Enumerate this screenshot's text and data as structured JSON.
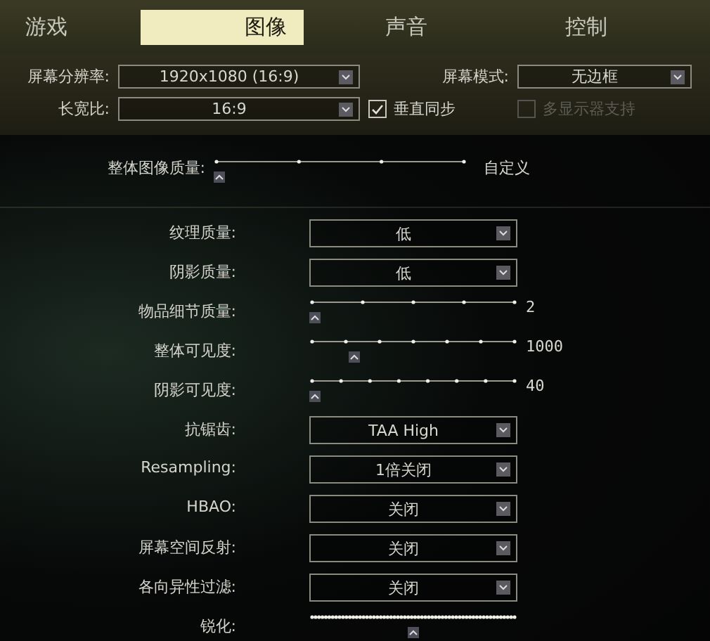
{
  "tabs": [
    {
      "label": "游戏",
      "selected": false
    },
    {
      "label": "图像",
      "selected": true
    },
    {
      "label": "声音",
      "selected": false
    },
    {
      "label": "控制",
      "selected": false
    }
  ],
  "resolution": {
    "label": "屏幕分辨率:",
    "value": "1920x1080 (16:9)"
  },
  "screen_mode": {
    "label": "屏幕模式:",
    "value": "无边框"
  },
  "aspect_ratio": {
    "label": "长宽比:",
    "value": "16:9"
  },
  "vsync": {
    "label": "垂直同步",
    "checked": true,
    "disabled": false
  },
  "multi_monitor": {
    "label": "多显示器支持",
    "checked": false,
    "disabled": true
  },
  "overall_quality": {
    "label": "整体图像质量:",
    "level": 0,
    "value": "自定义"
  },
  "settings": [
    {
      "kind": "select",
      "label": "纹理质量:",
      "value": "低"
    },
    {
      "kind": "select",
      "label": "阴影质量:",
      "value": "低"
    },
    {
      "kind": "slider",
      "label": "物品细节质量:",
      "level": 0,
      "value": "2"
    },
    {
      "kind": "slider",
      "label": "整体可见度:",
      "level": 0.2,
      "value": "1000"
    },
    {
      "kind": "slider",
      "label": "阴影可见度:",
      "level": 0,
      "value": "40"
    },
    {
      "kind": "select",
      "label": "抗锯齿:",
      "value": "TAA High"
    },
    {
      "kind": "select",
      "label": "Resampling:",
      "value": "1倍关闭"
    },
    {
      "kind": "select",
      "label": "HBAO:",
      "value": "关闭"
    },
    {
      "kind": "select",
      "label": "屏幕空间反射:",
      "value": "关闭"
    },
    {
      "kind": "select",
      "label": "各向异性过滤:",
      "value": "关闭"
    },
    {
      "kind": "slider",
      "label": "锐化:",
      "level": 0.5
    }
  ]
}
